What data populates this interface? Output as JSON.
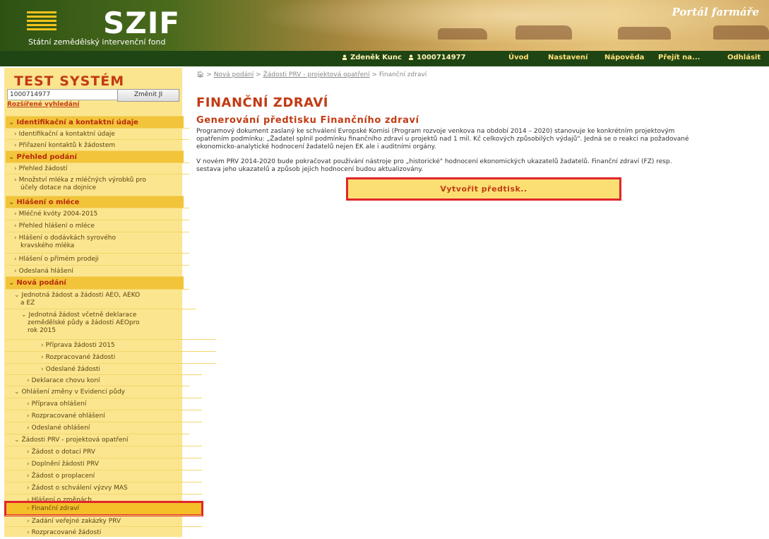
{
  "header": {
    "logo_text": "SZIF",
    "logo_subtitle": "Státní zemědělský intervenční fond",
    "portal_title": "Portál farmáře"
  },
  "topnav": {
    "user_name": "Zdeněk Kunc",
    "client_id": "1000714977",
    "items": [
      "Úvod",
      "Nastavení",
      "Nápověda",
      "Přejít na...",
      "Odhlásit"
    ]
  },
  "sidebar": {
    "system_title": "TEST SYSTÉM",
    "id_value": "1000714977",
    "change_button": "Změnit JI",
    "advanced_search": "Rozšířené vyhledání",
    "items": [
      {
        "label": "Identifikační a kontaktní údaje"
      },
      {
        "label": "Identifikační a kontaktní údaje"
      },
      {
        "label": "Přiřazení kontaktů k žádostem"
      },
      {
        "label": "Přehled podání"
      },
      {
        "label": "Přehled žádostí"
      },
      {
        "label": "Množství mléka z mléčných výrobků pro"
      },
      {
        "label": "účely dotace na dojnice"
      },
      {
        "label": "Hlášení o mléce"
      },
      {
        "label": "Mléčné kvóty 2004-2015"
      },
      {
        "label": "Přehled hlášení o mléce"
      },
      {
        "label": "Hlášení o dodávkách syrového"
      },
      {
        "label": "kravského mléka"
      },
      {
        "label": "Hlášení o přímém prodeji"
      },
      {
        "label": "Odeslaná hlášení"
      },
      {
        "label": "Nová podání"
      },
      {
        "label": "Jednotná žádost a žádosti AEO, AEKO"
      },
      {
        "label": "a EZ"
      },
      {
        "label": "Jednotná žádost včetně deklarace"
      },
      {
        "label": "zemědělské půdy a žádosti AEOpro"
      },
      {
        "label": "rok 2015"
      },
      {
        "label": "Příprava žádosti 2015"
      },
      {
        "label": "Rozpracované žádosti"
      },
      {
        "label": "Odeslané žádosti"
      },
      {
        "label": "Deklarace chovu koní"
      },
      {
        "label": "Ohlášení změny v Evidenci půdy"
      },
      {
        "label": "Příprava ohlášení"
      },
      {
        "label": "Rozpracované ohlášení"
      },
      {
        "label": "Odeslané ohlášení"
      },
      {
        "label": "Žádosti PRV - projektová opatření"
      },
      {
        "label": "Žádost o dotaci PRV"
      },
      {
        "label": "Doplnění žádosti PRV"
      },
      {
        "label": "Žádost o proplacení"
      },
      {
        "label": "Žádost o schválení výzvy MAS"
      },
      {
        "label": "Hlášení o změnách"
      },
      {
        "label": "Finanční zdraví"
      },
      {
        "label": "Zadání veřejné zakázky PRV"
      },
      {
        "label": "Rozpracované žádosti"
      }
    ]
  },
  "breadcrumb": {
    "items": [
      "Nová podání",
      "Žádosti PRV - projektová opatření"
    ],
    "current": "Finanční zdraví"
  },
  "main": {
    "title": "FINANČNÍ ZDRAVÍ",
    "subtitle": "Generování předtisku Finančního zdraví",
    "para1_line1": "Programový dokument zaslaný ke schválení Evropské Komisi (Program rozvoje venkova na období 2014 – 2020) stanovuje ke konkrétním projektovým",
    "para1_line2": "opatřením podmínku: „Žadatel splnil podmínku finančního zdraví u projektů nad 1 mil. Kč celkových způsobilých výdajů\". Jedná se o reakci na požadované",
    "para1_line3": "ekonomicko-analytické hodnocení žadatelů nejen EK ale i auditními orgány.",
    "para2_line1": "V novém PRV 2014-2020 bude pokračovat používání nástroje pro „historické\" hodnocení ekonomických ukazatelů žadatelů. Finanční zdraví (FZ) resp.",
    "para2_line2": "sestava jeho ukazatelů a způsob jejich hodnocení budou aktualizovány.",
    "create_button": "Vytvořit předtisk.."
  }
}
